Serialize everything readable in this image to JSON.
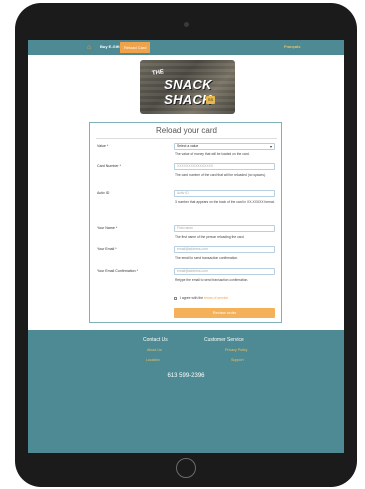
{
  "nav": {
    "buy": "Buy E-Gift",
    "reload": "Reload Card",
    "lang": "Français"
  },
  "logo": {
    "the": "THE",
    "name": "SNACK SHACK",
    "tag": "SS"
  },
  "form": {
    "title": "Reload your card",
    "value_label": "Value *",
    "value_selected": "Select a value",
    "value_help": "The value of money that will be loaded on the card.",
    "card_label": "Card Number *",
    "card_placeholder": "XXXXXXXXXXXXXXXX",
    "card_help": "The card number of the card that will be reloaded (no spaces).",
    "activ_label": "Activ ID",
    "activ_placeholder": "Activ ID",
    "activ_help": "3 number that appears on the back of the card in XX-XXXXX format.",
    "name_label": "Your Name *",
    "name_placeholder": "First name",
    "name_help": "The first name of the person reloading the card.",
    "email_label": "Your Email *",
    "email_placeholder": "email@address.com",
    "email_help": "The email to send transaction confirmation.",
    "confirm_label": "Your Email Confirmation *",
    "confirm_placeholder": "email@address.com",
    "confirm_help": "Retype the email to send transaction confirmation.",
    "agree_text": "I agree with the",
    "agree_link": "terms of service",
    "submit": "Review order"
  },
  "footer": {
    "contact_heading": "Contact Us",
    "service_heading": "Customer Service",
    "about": "About Us",
    "privacy": "Privacy Policy",
    "location": "Location",
    "support": "Support",
    "phone": "613 599-2396"
  },
  "colors": {
    "teal": "#4e8a94",
    "accent": "#f0a24a"
  }
}
